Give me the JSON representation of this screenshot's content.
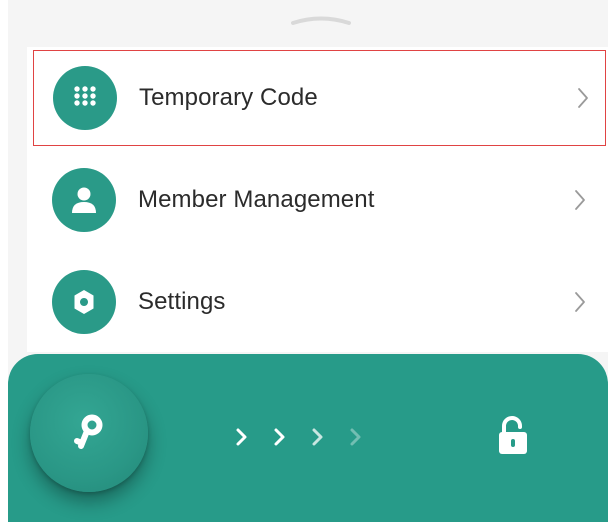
{
  "menu": {
    "items": [
      {
        "label": "Temporary Code",
        "icon": "keypad-icon",
        "highlighted": true
      },
      {
        "label": "Member Management",
        "icon": "person-icon",
        "highlighted": false
      },
      {
        "label": "Settings",
        "icon": "gear-icon",
        "highlighted": false
      }
    ]
  },
  "unlock_bar": {
    "key_icon": "key-icon",
    "arrow_icon": "chevron-right-icon",
    "lock_icon": "unlock-icon"
  },
  "colors": {
    "accent": "#2a9a88",
    "highlight_border": "#e04343",
    "text": "#2b2b2b",
    "sheet_background": "#f5f5f5"
  }
}
